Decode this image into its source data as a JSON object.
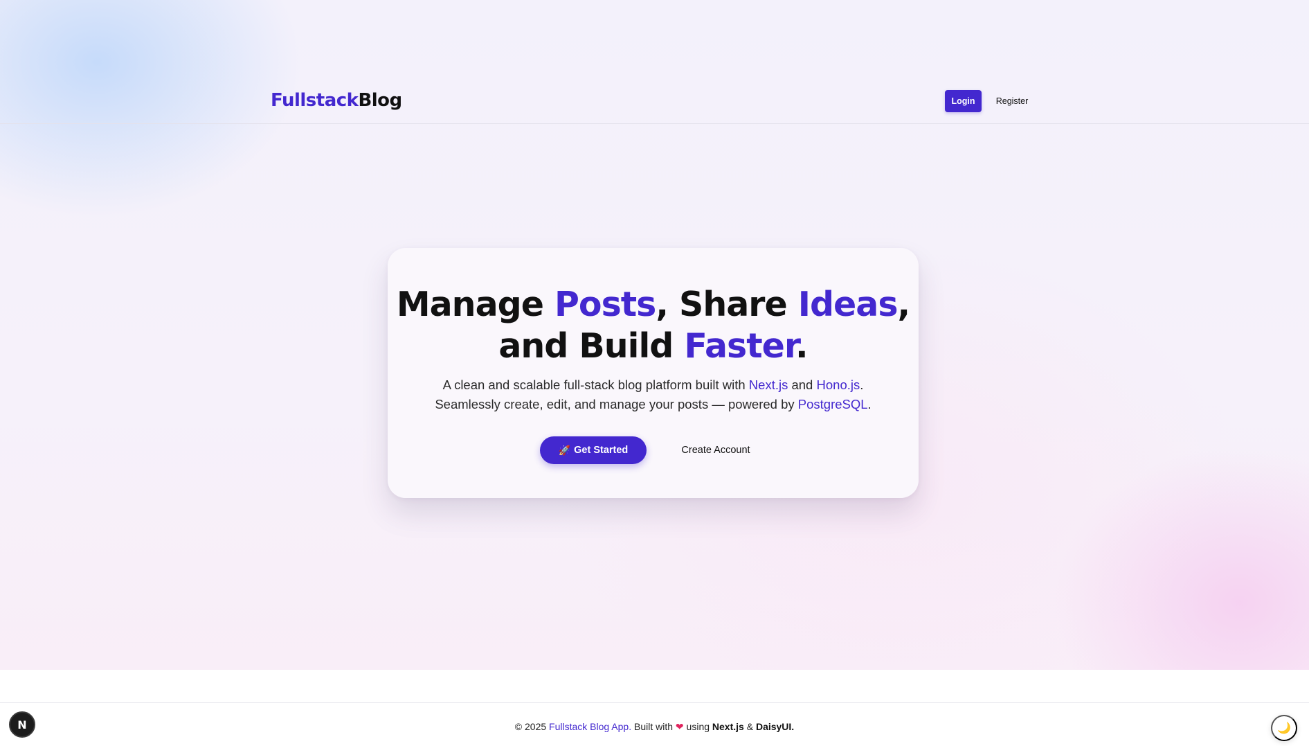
{
  "brand": {
    "part1": "Fullstack",
    "part2": "Blog"
  },
  "nav": {
    "login_label": "Login",
    "register_label": "Register"
  },
  "hero": {
    "line1_a": "Manage ",
    "line1_b": "Posts",
    "line1_c": ", Share ",
    "line1_d": "Ideas",
    "line1_e": ",",
    "line2_a": "and Build ",
    "line2_b": "Faster",
    "line2_c": ".",
    "sub_1": "A clean and scalable full-stack blog platform built with ",
    "sub_nextjs": "Next.js",
    "sub_2": " and ",
    "sub_honojs": "Hono.js",
    "sub_3": ". Seamlessly create, edit, and manage your posts — powered by ",
    "sub_postgres": "PostgreSQL",
    "sub_4": ".",
    "get_started_icon": "🚀",
    "get_started_label": "Get Started",
    "create_account_label": "Create Account"
  },
  "footer": {
    "copyright": "© 2025 ",
    "app_name": "Fullstack Blog App.",
    "built_with": " Built with ",
    "heart": "❤",
    "using": " using ",
    "nextjs": "Next.js",
    "amp": " & ",
    "daisyui": "DaisyUI."
  },
  "badges": {
    "next_letter": "N",
    "theme_icon": "🌙"
  },
  "colors": {
    "accent": "#4328cf",
    "text": "#111111",
    "heart": "#e0245e"
  }
}
